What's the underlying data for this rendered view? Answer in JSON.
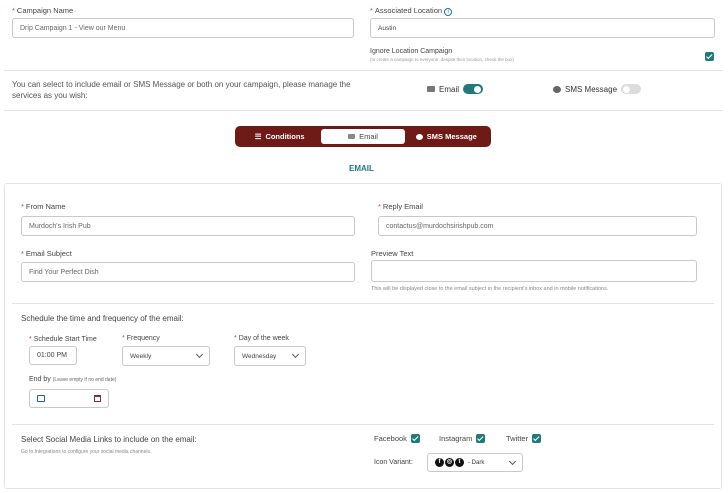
{
  "campaign": {
    "name_label": "Campaign Name",
    "name_placeholder": "Drip Campaign 1 - View our Menu",
    "location_label": "Associated Location",
    "location_value": "Austin",
    "ignore_label": "Ignore Location Campaign",
    "ignore_hint": "(to create a campaign to everyone, despite their location, check the box)",
    "ignore_checked": true
  },
  "services": {
    "description": "You can select to include email or SMS Message or both on your campaign, please manage the services as you wish:",
    "email_label": "Email",
    "email_on": true,
    "sms_label": "SMS Message",
    "sms_on": false
  },
  "tabs": [
    {
      "label": "Conditions",
      "active": false
    },
    {
      "label": "Email",
      "active": true
    },
    {
      "label": "SMS Message",
      "active": false
    }
  ],
  "section_title": "EMAIL",
  "email": {
    "from_label": "From Name",
    "from_value": "Murdoch's Irish Pub",
    "reply_label": "Reply Email",
    "reply_value": "contactus@murdochsirishpub.com",
    "subject_label": "Email Subject",
    "subject_value": "Find Your Perfect Dish",
    "preview_label": "Preview Text",
    "preview_value": "",
    "preview_hint": "This will be displayed close to the email subject in the recipient's inbox and in mobile notifications."
  },
  "schedule": {
    "heading": "Schedule the time and frequency of the email:",
    "start_label": "Schedule Start Time",
    "start_value": "01:00 PM",
    "frequency_label": "Frequency",
    "frequency_value": "Weekly",
    "day_label": "Day of the week",
    "day_value": "Wednesday",
    "end_label": "End by",
    "end_hint": "(Leave empty if no end date)",
    "end_value": ""
  },
  "social": {
    "heading": "Select Social Media Links to include on the email:",
    "hint": "Go to Integrations to configure your social media channels.",
    "facebook_label": "Facebook",
    "instagram_label": "Instagram",
    "twitter_label": "Twitter",
    "variant_label": "Icon Variant:",
    "variant_value": "- Dark"
  },
  "colors": {
    "accent": "#1f7a7a",
    "tab_bar": "#6e1a17",
    "required": "#d9363e"
  }
}
